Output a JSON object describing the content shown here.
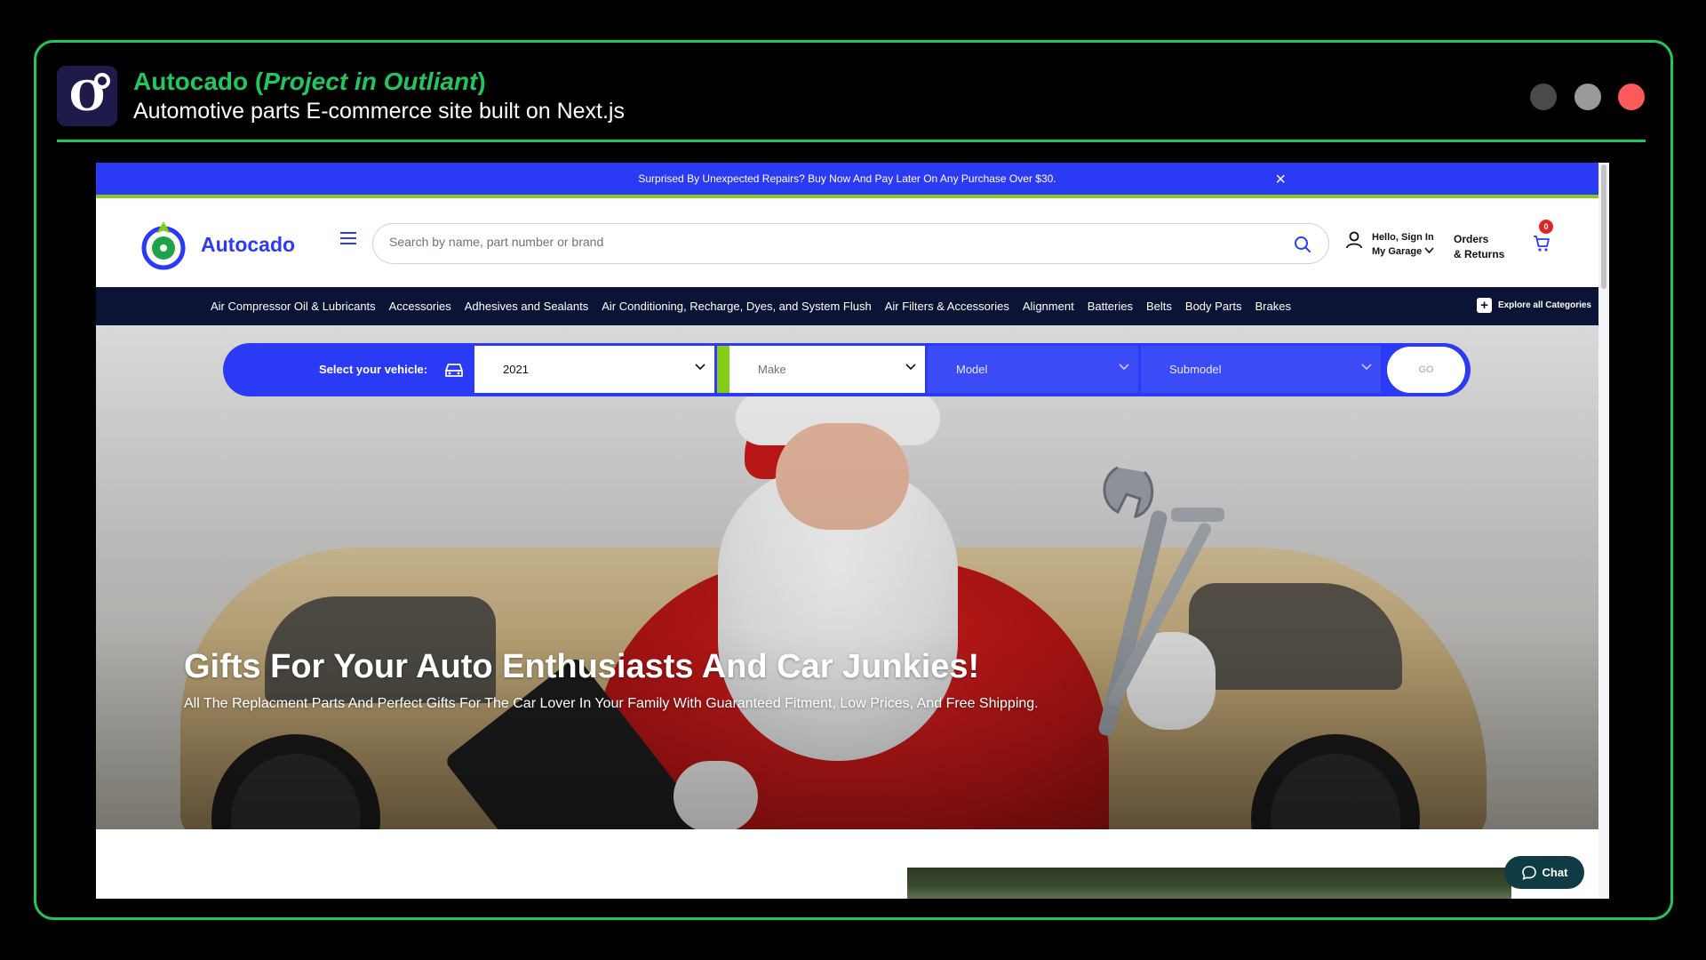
{
  "header": {
    "logo_letter": "O",
    "title_name": "Autocado (",
    "title_italic": "Project in Outliant",
    "title_close": ")",
    "subtitle": "Automotive parts E-commerce site built on Next.js",
    "window_dots": [
      "#4a4a4a",
      "#9a9a9a",
      "#ff5a5a"
    ]
  },
  "promo": {
    "text": "Surprised By Unexpected Repairs? Buy Now And Pay Later On Any Purchase Over $30.",
    "close_icon": "×"
  },
  "topbar": {
    "brand": "Autocado",
    "search_placeholder": "Search by name, part number or brand",
    "account_greeting": "Hello, Sign In",
    "account_garage": "My Garage",
    "orders_line1": "Orders",
    "orders_line2": "& Returns",
    "cart_count": "0"
  },
  "categories": {
    "items": [
      "Air Compressor Oil & Lubricants",
      "Accessories",
      "Adhesives and Sealants",
      "Air Conditioning, Recharge, Dyes, and System Flush",
      "Air Filters & Accessories",
      "Alignment",
      "Batteries",
      "Belts",
      "Body Parts",
      "Brakes"
    ],
    "explore_label": "Explore all Categories",
    "explore_icon": "+"
  },
  "vehicle": {
    "label": "Select your vehicle:",
    "year": "2021",
    "make": "Make",
    "model": "Model",
    "submodel": "Submodel",
    "go": "GO"
  },
  "hero": {
    "title": "Gifts For Your Auto Enthusiasts And Car Junkies!",
    "subtitle": "All The Replacment Parts And Perfect Gifts For The Car Lover In Your Family With Guaranteed Fitment, Low Prices, And Free Shipping."
  },
  "chat": {
    "label": "Chat"
  },
  "colors": {
    "accent_green": "#22c55e",
    "brand_blue": "#2b3bf5",
    "nav_dark": "#0b1435",
    "lime": "#84cc16"
  }
}
